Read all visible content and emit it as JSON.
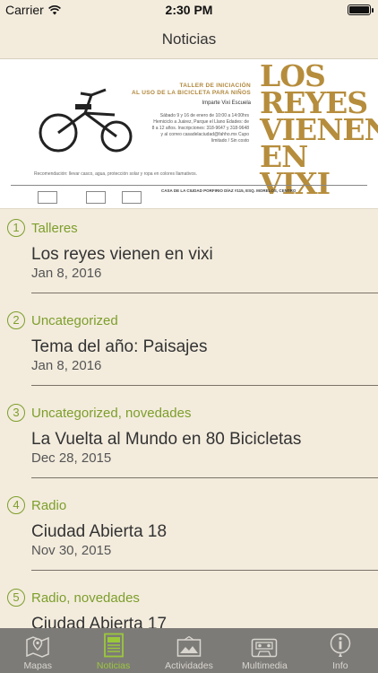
{
  "status": {
    "carrier": "Carrier",
    "time": "2:30 PM"
  },
  "nav": {
    "title": "Noticias"
  },
  "banner": {
    "headline_1": "TALLER DE INICIACIÓN",
    "headline_2": "AL USO DE LA BICICLETA PARA NIÑOS",
    "subtitle": "Imparte Vixi Escuela",
    "details": "Sábado 9 y 16 de enero de 10:00 a 14:00hrs Hemiciclo a Juárez, Parque el Llano Edades: de 8 a 12 años. Inscripciones: 318-9647 y 318-9648 y al correo casadelaciudad@fahho.mx Cupo limitado / Sin costo",
    "recommendation": "Recomendación: llevar casco, agua, protección solar y ropa en colores llamativos.",
    "big_title": "Los reyes vienen en vixi",
    "address": "CASA DE LA CIUDAD PORFIRIO DÍAZ #115, ESQ. MORELOS, CENTRO"
  },
  "news": [
    {
      "num": "1",
      "category": "Talleres",
      "title": "Los reyes vienen en vixi",
      "date": "Jan 8, 2016"
    },
    {
      "num": "2",
      "category": "Uncategorized",
      "title": "Tema del año: Paisajes",
      "date": "Jan 8, 2016"
    },
    {
      "num": "3",
      "category": "Uncategorized, novedades",
      "title": "La Vuelta al Mundo en 80 Bicicletas",
      "date": "Dec 28, 2015"
    },
    {
      "num": "4",
      "category": "Radio",
      "title": "Ciudad Abierta 18",
      "date": "Nov 30, 2015"
    },
    {
      "num": "5",
      "category": "Radio, novedades",
      "title": "Ciudad Abierta 17",
      "date": ""
    }
  ],
  "tabs": [
    {
      "label": "Mapas",
      "icon": "map-icon"
    },
    {
      "label": "Noticias",
      "icon": "newspaper-icon",
      "active": true
    },
    {
      "label": "Actividades",
      "icon": "picture-icon"
    },
    {
      "label": "Multimedia",
      "icon": "cassette-icon"
    },
    {
      "label": "Info",
      "icon": "info-icon"
    }
  ],
  "colors": {
    "accent": "#7d9e2b",
    "tab_active": "#9bc83a",
    "background": "#f3ecdd",
    "tabbar": "#7d7b78"
  }
}
